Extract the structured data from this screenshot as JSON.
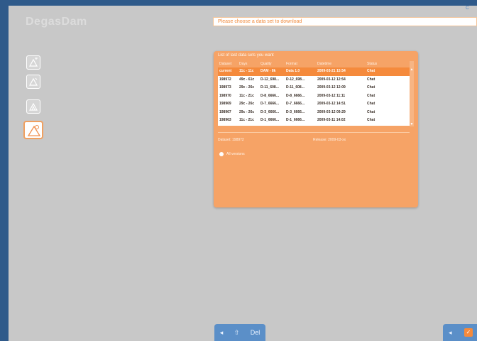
{
  "app": {
    "logo": "DegasDam"
  },
  "notice": {
    "text": "Please choose a data set to download"
  },
  "corner_top": "C",
  "tools": [
    {
      "icon": "triangle-add-icon"
    },
    {
      "icon": "triangle-edit-icon"
    },
    {
      "icon": "triangle-stack-icon"
    },
    {
      "icon": "bell-triangle-icon",
      "active": true
    }
  ],
  "panel": {
    "title": "List of last data sets you want",
    "columns": [
      "Dataset",
      "Days",
      "Quality",
      "Format",
      "Datetime",
      "Status"
    ],
    "rows": [
      [
        "current",
        "11c - 11c",
        "DAM - 8k",
        "Data 1.0",
        "2009-03-21 15:54",
        "Chat"
      ],
      [
        "198972",
        "49c - 61c",
        "D-12_698...",
        "D-12_698...",
        "2009-03-12 12:54",
        "Chat"
      ],
      [
        "198973",
        "29c - 26c",
        "D-11_608...",
        "D-11_608...",
        "2009-03-12 12:09",
        "Chat"
      ],
      [
        "198970",
        "11c - 21c",
        "D-8_6666...",
        "D-8_6666...",
        "2009-03-12 11:11",
        "Chat"
      ],
      [
        "198969",
        "29c - 26c",
        "D-7_6666...",
        "D-7_6666...",
        "2009-03-12 14:51",
        "Chat"
      ],
      [
        "198967",
        "29c - 26c",
        "D-3_6666...",
        "D-3_6666...",
        "2009-03-12 09:29",
        "Chat"
      ],
      [
        "198963",
        "11c - 21c",
        "D-1_6666...",
        "D-1_6666...",
        "2009-03-11 14:02",
        "Chat"
      ]
    ],
    "selected_row": 0,
    "info_left": "Dataset: 198972",
    "info_right": "Release: 2009-03-xx",
    "radio_label": "All versions"
  },
  "bottom_bar": {
    "btn1": "◂",
    "btn2": "⇧",
    "btn3": "Del"
  },
  "corner": {
    "btn1": "◂",
    "btn2": "✓"
  },
  "colors": {
    "accent": "#f58a3c",
    "panel": "#f6a366",
    "bar": "#5b8fc8",
    "background": "#c8c8c8"
  }
}
